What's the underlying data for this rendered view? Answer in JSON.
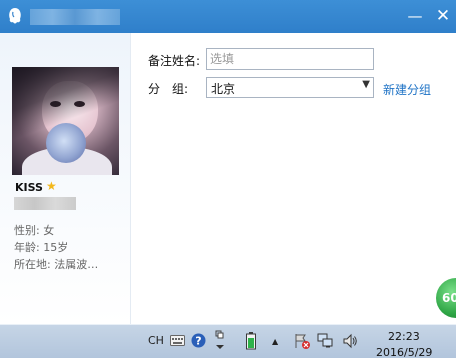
{
  "window": {
    "icon": "qq-penguin-icon",
    "minimize_glyph": "—",
    "close_glyph": "✕"
  },
  "profile": {
    "username": "KISS",
    "star_glyph": "★",
    "gender": "性别: 女",
    "age": "年龄: 15岁",
    "location": "所在地: 法属波…"
  },
  "form": {
    "remark_label": "备注姓名:",
    "remark_placeholder": "选填",
    "group_label": "分　组:",
    "group_value": "北京",
    "new_group_link": "新建分组"
  },
  "badge": {
    "text": "60"
  },
  "taskbar": {
    "ime": "CH",
    "time": "22:23",
    "date": "2016/5/29"
  },
  "colors": {
    "titlebar": "#2f7fca",
    "link": "#1f73c6",
    "taskbar": "#b2c5dc"
  }
}
